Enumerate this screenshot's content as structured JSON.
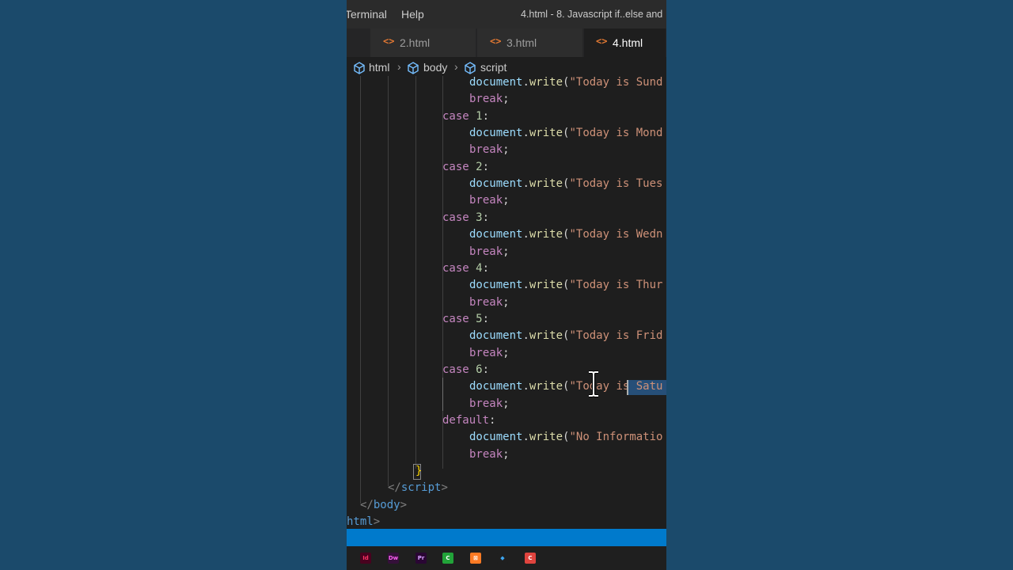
{
  "menu": {
    "items": [
      "Terminal",
      "Help"
    ],
    "window_title": "4.html - 8. Javascript if..else and"
  },
  "tabs": [
    {
      "label": "2.html",
      "active": false,
      "icon": "html-brackets-icon"
    },
    {
      "label": "3.html",
      "active": false,
      "icon": "html-brackets-icon"
    },
    {
      "label": "4.html",
      "active": true,
      "icon": "html-brackets-icon"
    }
  ],
  "breadcrumb": [
    "html",
    "body",
    "script"
  ],
  "code_lines": [
    [
      [
        "document",
        "t-var"
      ],
      [
        ".",
        "t-punc"
      ],
      [
        "write",
        "t-fn"
      ],
      [
        "(",
        "t-punc"
      ],
      [
        "\"Today is Sund",
        "t-str"
      ]
    ],
    [
      [
        "break",
        "t-kw"
      ],
      [
        ";",
        "t-punc"
      ]
    ],
    [
      [
        "case ",
        "t-kw"
      ],
      [
        "1",
        "t-num"
      ],
      [
        ":",
        "t-punc"
      ]
    ],
    [
      [
        "document",
        "t-var"
      ],
      [
        ".",
        "t-punc"
      ],
      [
        "write",
        "t-fn"
      ],
      [
        "(",
        "t-punc"
      ],
      [
        "\"Today is Mond",
        "t-str"
      ]
    ],
    [
      [
        "break",
        "t-kw"
      ],
      [
        ";",
        "t-punc"
      ]
    ],
    [
      [
        "case ",
        "t-kw"
      ],
      [
        "2",
        "t-num"
      ],
      [
        ":",
        "t-punc"
      ]
    ],
    [
      [
        "document",
        "t-var"
      ],
      [
        ".",
        "t-punc"
      ],
      [
        "write",
        "t-fn"
      ],
      [
        "(",
        "t-punc"
      ],
      [
        "\"Today is Tues",
        "t-str"
      ]
    ],
    [
      [
        "break",
        "t-kw"
      ],
      [
        ";",
        "t-punc"
      ]
    ],
    [
      [
        "case ",
        "t-kw"
      ],
      [
        "3",
        "t-num"
      ],
      [
        ":",
        "t-punc"
      ]
    ],
    [
      [
        "document",
        "t-var"
      ],
      [
        ".",
        "t-punc"
      ],
      [
        "write",
        "t-fn"
      ],
      [
        "(",
        "t-punc"
      ],
      [
        "\"Today is Wedn",
        "t-str"
      ]
    ],
    [
      [
        "break",
        "t-kw"
      ],
      [
        ";",
        "t-punc"
      ]
    ],
    [
      [
        "case ",
        "t-kw"
      ],
      [
        "4",
        "t-num"
      ],
      [
        ":",
        "t-punc"
      ]
    ],
    [
      [
        "document",
        "t-var"
      ],
      [
        ".",
        "t-punc"
      ],
      [
        "write",
        "t-fn"
      ],
      [
        "(",
        "t-punc"
      ],
      [
        "\"Today is Thur",
        "t-str"
      ]
    ],
    [
      [
        "break",
        "t-kw"
      ],
      [
        ";",
        "t-punc"
      ]
    ],
    [
      [
        "case ",
        "t-kw"
      ],
      [
        "5",
        "t-num"
      ],
      [
        ":",
        "t-punc"
      ]
    ],
    [
      [
        "document",
        "t-var"
      ],
      [
        ".",
        "t-punc"
      ],
      [
        "write",
        "t-fn"
      ],
      [
        "(",
        "t-punc"
      ],
      [
        "\"Today is Frid",
        "t-str"
      ]
    ],
    [
      [
        "break",
        "t-kw"
      ],
      [
        ";",
        "t-punc"
      ]
    ],
    [
      [
        "case ",
        "t-kw"
      ],
      [
        "6",
        "t-num"
      ],
      [
        ":",
        "t-punc"
      ]
    ],
    [
      [
        "document",
        "t-var"
      ],
      [
        ".",
        "t-punc"
      ],
      [
        "write",
        "t-fn"
      ],
      [
        "(",
        "t-punc"
      ],
      [
        "\"Today is Satu",
        "t-str"
      ]
    ],
    [
      [
        "break",
        "t-kw"
      ],
      [
        ";",
        "t-punc"
      ]
    ],
    [
      [
        "default",
        "t-kw"
      ],
      [
        ":",
        "t-punc"
      ]
    ],
    [
      [
        "document",
        "t-var"
      ],
      [
        ".",
        "t-punc"
      ],
      [
        "write",
        "t-fn"
      ],
      [
        "(",
        "t-punc"
      ],
      [
        "\"No Informatio",
        "t-str"
      ]
    ],
    [
      [
        "break",
        "t-kw"
      ],
      [
        ";",
        "t-punc"
      ]
    ],
    [
      [
        "}",
        "t-brace"
      ]
    ],
    [
      [
        "</",
        "t-tag"
      ],
      [
        "script",
        "t-tagname"
      ],
      [
        ">",
        "t-tag"
      ]
    ],
    [
      [
        "</",
        "t-tag"
      ],
      [
        "body",
        "t-tagname"
      ],
      [
        ">",
        "t-tag"
      ]
    ],
    [
      [
        "html",
        "t-tagname"
      ],
      [
        ">",
        "t-tag"
      ]
    ]
  ],
  "taskbar_apps": [
    {
      "name": "indesign-icon",
      "label": "Id",
      "bg": "#49021f",
      "fg": "#ff3366"
    },
    {
      "name": "dreamweaver-icon",
      "label": "Dw",
      "bg": "#35103a",
      "fg": "#ff61f6"
    },
    {
      "name": "premiere-icon",
      "label": "Pr",
      "bg": "#2a0634",
      "fg": "#d8a1ff"
    },
    {
      "name": "green-app-icon",
      "label": "C",
      "bg": "#22a339",
      "fg": "#ffffff"
    },
    {
      "name": "xampp-icon",
      "label": "⊠",
      "bg": "#fb7a24",
      "fg": "#ffffff"
    },
    {
      "name": "vscode-icon",
      "label": "◆",
      "bg": "#1f1f1f",
      "fg": "#3ea6f0"
    },
    {
      "name": "red-app-icon",
      "label": "C",
      "bg": "#e0443e",
      "fg": "#ffffff"
    }
  ],
  "colors": {
    "status_bar": "#007acc",
    "background": "#1b4a6b",
    "editor": "#1e1e1e"
  }
}
